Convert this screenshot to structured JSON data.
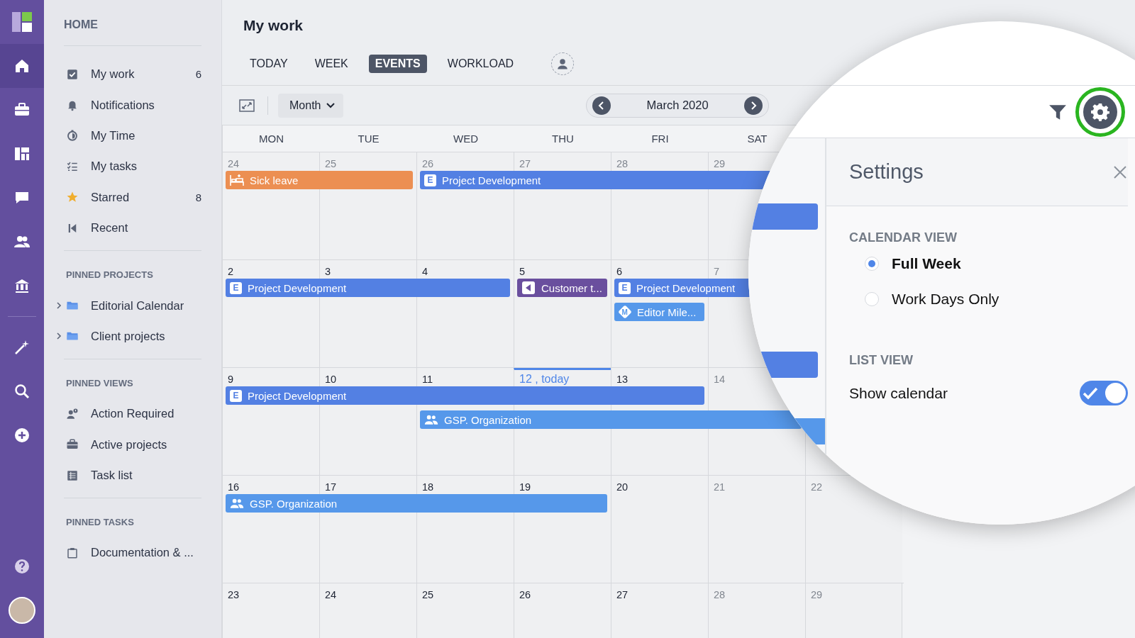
{
  "rail": {
    "items": [
      {
        "selected": true
      },
      {
        "selected": false
      },
      {
        "selected": false
      },
      {
        "selected": false
      },
      {
        "selected": false
      },
      {
        "selected": false
      },
      {
        "selected": false
      },
      {
        "selected": false
      },
      {
        "selected": false
      },
      {
        "selected": false
      }
    ]
  },
  "sidebar": {
    "title": "HOME",
    "items": [
      {
        "label": "My work",
        "count": "6"
      },
      {
        "label": "Notifications"
      },
      {
        "label": "My Time"
      },
      {
        "label": "My tasks"
      },
      {
        "label": "Starred",
        "count": "8"
      },
      {
        "label": "Recent"
      }
    ],
    "sections": [
      {
        "title": "PINNED PROJECTS",
        "items": [
          {
            "label": "Editorial Calendar",
            "expanded": false
          },
          {
            "label": "Client projects",
            "expanded": false
          }
        ]
      },
      {
        "title": "PINNED VIEWS",
        "items": [
          {
            "label": "Action Required"
          },
          {
            "label": "Active projects"
          },
          {
            "label": "Task list"
          }
        ]
      },
      {
        "title": "PINNED TASKS",
        "items": [
          {
            "label": "Documentation & ..."
          }
        ]
      }
    ]
  },
  "page": {
    "title": "My work"
  },
  "tabs": [
    {
      "label": "TODAY",
      "selected": false
    },
    {
      "label": "WEEK",
      "selected": false
    },
    {
      "label": "EVENTS",
      "selected": true
    },
    {
      "label": "WORKLOAD",
      "selected": false
    }
  ],
  "toolbar": {
    "view": "Month",
    "period": "March 2020"
  },
  "calendar": {
    "weekdays": [
      "MON",
      "TUE",
      "WED",
      "THU",
      "FRI",
      "SAT"
    ],
    "weeks": [
      {
        "days": [
          {
            "day": "24",
            "muted": true,
            "today": false,
            "events": [
              {
                "kind": "leave",
                "title": "Sick leave",
                "color": "#ec8f52"
              }
            ]
          },
          {
            "day": "25",
            "muted": true,
            "today": false,
            "events": [
              {
                "kind": "continuation"
              }
            ]
          },
          {
            "day": "26",
            "muted": true,
            "today": false,
            "events": [
              {
                "kind": "project",
                "title": "Project Development",
                "badge": "E",
                "color": "#5380e3"
              }
            ]
          },
          {
            "day": "27",
            "muted": true,
            "today": false,
            "events": [
              {
                "kind": "continuation"
              }
            ]
          },
          {
            "day": "28",
            "muted": true,
            "today": false,
            "events": [
              {
                "kind": "continuation"
              }
            ]
          },
          {
            "day": "29",
            "muted": true,
            "today": false,
            "events": [
              {
                "kind": "continuation"
              }
            ]
          }
        ]
      },
      {
        "days": [
          {
            "day": "2",
            "muted": false,
            "today": false,
            "events": [
              {
                "kind": "project",
                "title": "Project Development",
                "badge": "E",
                "color": "#5380e3"
              }
            ]
          },
          {
            "day": "3",
            "muted": false,
            "today": false,
            "events": [
              {
                "kind": "continuation"
              }
            ]
          },
          {
            "day": "4",
            "muted": false,
            "today": false,
            "events": [
              {
                "kind": "continuation"
              }
            ]
          },
          {
            "day": "5",
            "muted": false,
            "today": false,
            "events": [
              {
                "kind": "meeting",
                "title": "Customer t...",
                "color": "#6a4f9e"
              }
            ]
          },
          {
            "day": "6",
            "muted": false,
            "today": false,
            "events": [
              {
                "kind": "project",
                "title": "Project Development",
                "badge": "E",
                "color": "#5380e3"
              },
              {
                "kind": "milestone",
                "title": "Editor Mile...",
                "badge": "M",
                "color": "#5698ea"
              }
            ]
          },
          {
            "day": "7",
            "muted": true,
            "today": false,
            "events": [
              {
                "kind": "continuation"
              }
            ]
          }
        ]
      },
      {
        "days": [
          {
            "day": "9",
            "muted": false,
            "today": false,
            "events": [
              {
                "kind": "project",
                "title": "Project Development",
                "badge": "E",
                "color": "#5380e3"
              }
            ]
          },
          {
            "day": "10",
            "muted": false,
            "today": false,
            "events": [
              {
                "kind": "continuation"
              }
            ]
          },
          {
            "day": "11",
            "muted": false,
            "today": false,
            "events": [
              {
                "kind": "continuation"
              },
              {
                "kind": "group",
                "title": "GSP. Organization",
                "color": "#5698ea"
              }
            ]
          },
          {
            "day": "12 , today",
            "muted": false,
            "today": true,
            "events": [
              {
                "kind": "continuation"
              },
              {
                "kind": "continuation"
              }
            ]
          },
          {
            "day": "13",
            "muted": false,
            "today": false,
            "events": [
              {
                "kind": "continuation"
              },
              {
                "kind": "continuation"
              }
            ]
          },
          {
            "day": "14",
            "muted": true,
            "today": false,
            "events": [
              {
                "kind": "gap"
              },
              {
                "kind": "continuation"
              }
            ]
          }
        ]
      },
      {
        "days": [
          {
            "day": "16",
            "muted": false,
            "today": false,
            "events": [
              {
                "kind": "group",
                "title": "GSP. Organization",
                "color": "#5698ea"
              }
            ]
          },
          {
            "day": "17",
            "muted": false,
            "today": false,
            "events": [
              {
                "kind": "continuation"
              }
            ]
          },
          {
            "day": "18",
            "muted": false,
            "today": false,
            "events": [
              {
                "kind": "continuation"
              }
            ]
          },
          {
            "day": "19",
            "muted": false,
            "today": false,
            "events": [
              {
                "kind": "continuation"
              }
            ]
          },
          {
            "day": "20",
            "muted": false,
            "today": false
          },
          {
            "day": "21",
            "muted": true,
            "today": false
          },
          {
            "day": "22",
            "muted": true,
            "today": false
          }
        ]
      },
      {
        "days": [
          {
            "day": "23",
            "muted": false,
            "today": false
          },
          {
            "day": "24",
            "muted": false,
            "today": false
          },
          {
            "day": "25",
            "muted": false,
            "today": false
          },
          {
            "day": "26",
            "muted": false,
            "today": false
          },
          {
            "day": "27",
            "muted": false,
            "today": false
          },
          {
            "day": "28",
            "muted": true,
            "today": false
          },
          {
            "day": "29",
            "muted": true,
            "today": false
          }
        ]
      }
    ]
  },
  "settings": {
    "title": "Settings",
    "sections": [
      {
        "title": "CALENDAR VIEW",
        "kind": "radio",
        "options": [
          {
            "label": "Full Week",
            "selected": true
          },
          {
            "label": "Work Days Only",
            "selected": false
          }
        ]
      },
      {
        "title": "LIST VIEW",
        "kind": "toggle",
        "options": [
          {
            "label": "Show calendar",
            "on": true
          }
        ]
      }
    ]
  }
}
